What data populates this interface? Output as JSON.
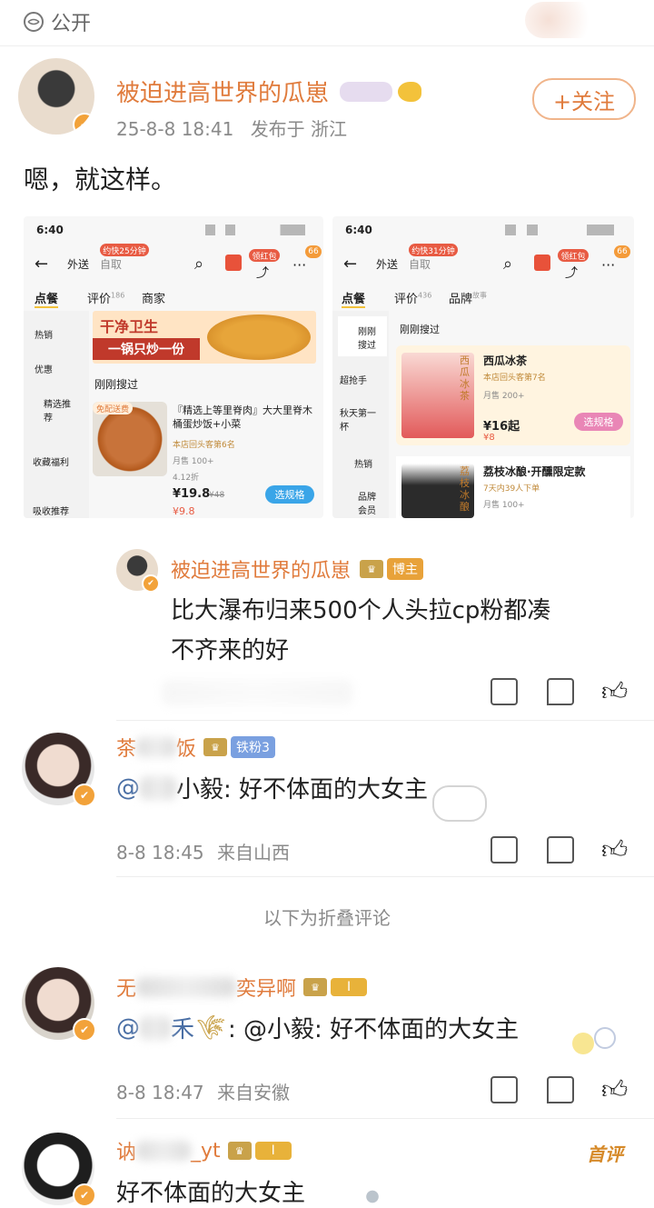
{
  "header": {
    "visibility": "公开"
  },
  "post": {
    "username": "被迫进高世界的瓜崽",
    "timestamp": "25-8-8 18:41",
    "location": "发布于 浙江",
    "follow_label": "+关注",
    "text": "嗯，就这样。"
  },
  "shot_left": {
    "time": "6:40",
    "tab_delivery": "外送",
    "tab_pickup": "自取",
    "delivery_badge": "约快25分钟",
    "nav_order": "点餐",
    "nav_review": "评价",
    "nav_review_count": "186",
    "nav_store": "商家",
    "side": [
      "热销",
      "优惠",
      "精选推荐",
      "收藏福利",
      "吸收推荐"
    ],
    "banner_line1": "干净卫生",
    "banner_line2": "一锅只炒一份",
    "section": "刚刚搜过",
    "free_ship": "免配送费",
    "product_name": "『精选上等里脊肉』大大里脊木桶蛋炒饭+小菜",
    "product_repurchase": "本店回头客第6名",
    "product_sales": "月售 100+",
    "product_discount": "4.12折",
    "price": "¥19.8",
    "orig_price": "¥48",
    "coupon_price": "¥9.8",
    "select_btn": "选规格",
    "red_packet": "领红包",
    "count_badge": "66"
  },
  "shot_right": {
    "time": "6:40",
    "tab_delivery": "外送",
    "tab_pickup": "自取",
    "delivery_badge": "约快31分钟",
    "nav_order": "点餐",
    "nav_review": "评价",
    "nav_review_count": "436",
    "nav_brand": "品牌",
    "nav_brand_sub": "故事",
    "side": [
      "刚刚搜过",
      "超抢手",
      "秋天第一杯",
      "热销",
      "品牌会员"
    ],
    "section": "刚刚搜过",
    "p1_name": "西瓜冰茶",
    "p1_repurchase": "本店回头客第7名",
    "p1_sales": "月售 200+",
    "p1_price": "¥16起",
    "p1_coupon": "¥8",
    "p1_img_text": "西瓜冰茶",
    "p2_name": "荔枝冰酿·开醺限定款",
    "p2_sub": "7天内39人下单",
    "p2_sales": "月售 100+",
    "p2_img_text": "荔枝冰酿",
    "select_btn": "选规格",
    "red_packet": "领红包",
    "count_badge": "66"
  },
  "comments": [
    {
      "username": "被迫进高世界的瓜崽",
      "badge": "博主",
      "text_line1": "比大瀑布归来500个人头拉cp粉都凑",
      "text_line2": "不齐来的好"
    },
    {
      "username_a": "茶",
      "username_b": "饭",
      "badge": "铁粉3",
      "mention": "@",
      "text": "小毅: 好不体面的大女主",
      "time": "8-8 18:45",
      "location": "来自山西"
    },
    {
      "username_a": "无",
      "username_b": "奕异啊",
      "badge": "I",
      "text_prefix": "@",
      "text_mid": "禾",
      "text": ": @小毅: 好不体面的大女主",
      "time": "8-8 18:47",
      "location": "来自安徽"
    },
    {
      "username_a": "讷",
      "username_b": "_yt",
      "badge": "I",
      "first_label": "首评",
      "text": "好不体面的大女主"
    }
  ],
  "folded_label": "以下为折叠评论",
  "colors": {
    "accent": "#e07b3c",
    "muted": "#8a8a8a",
    "gold": "#c9a24a"
  }
}
